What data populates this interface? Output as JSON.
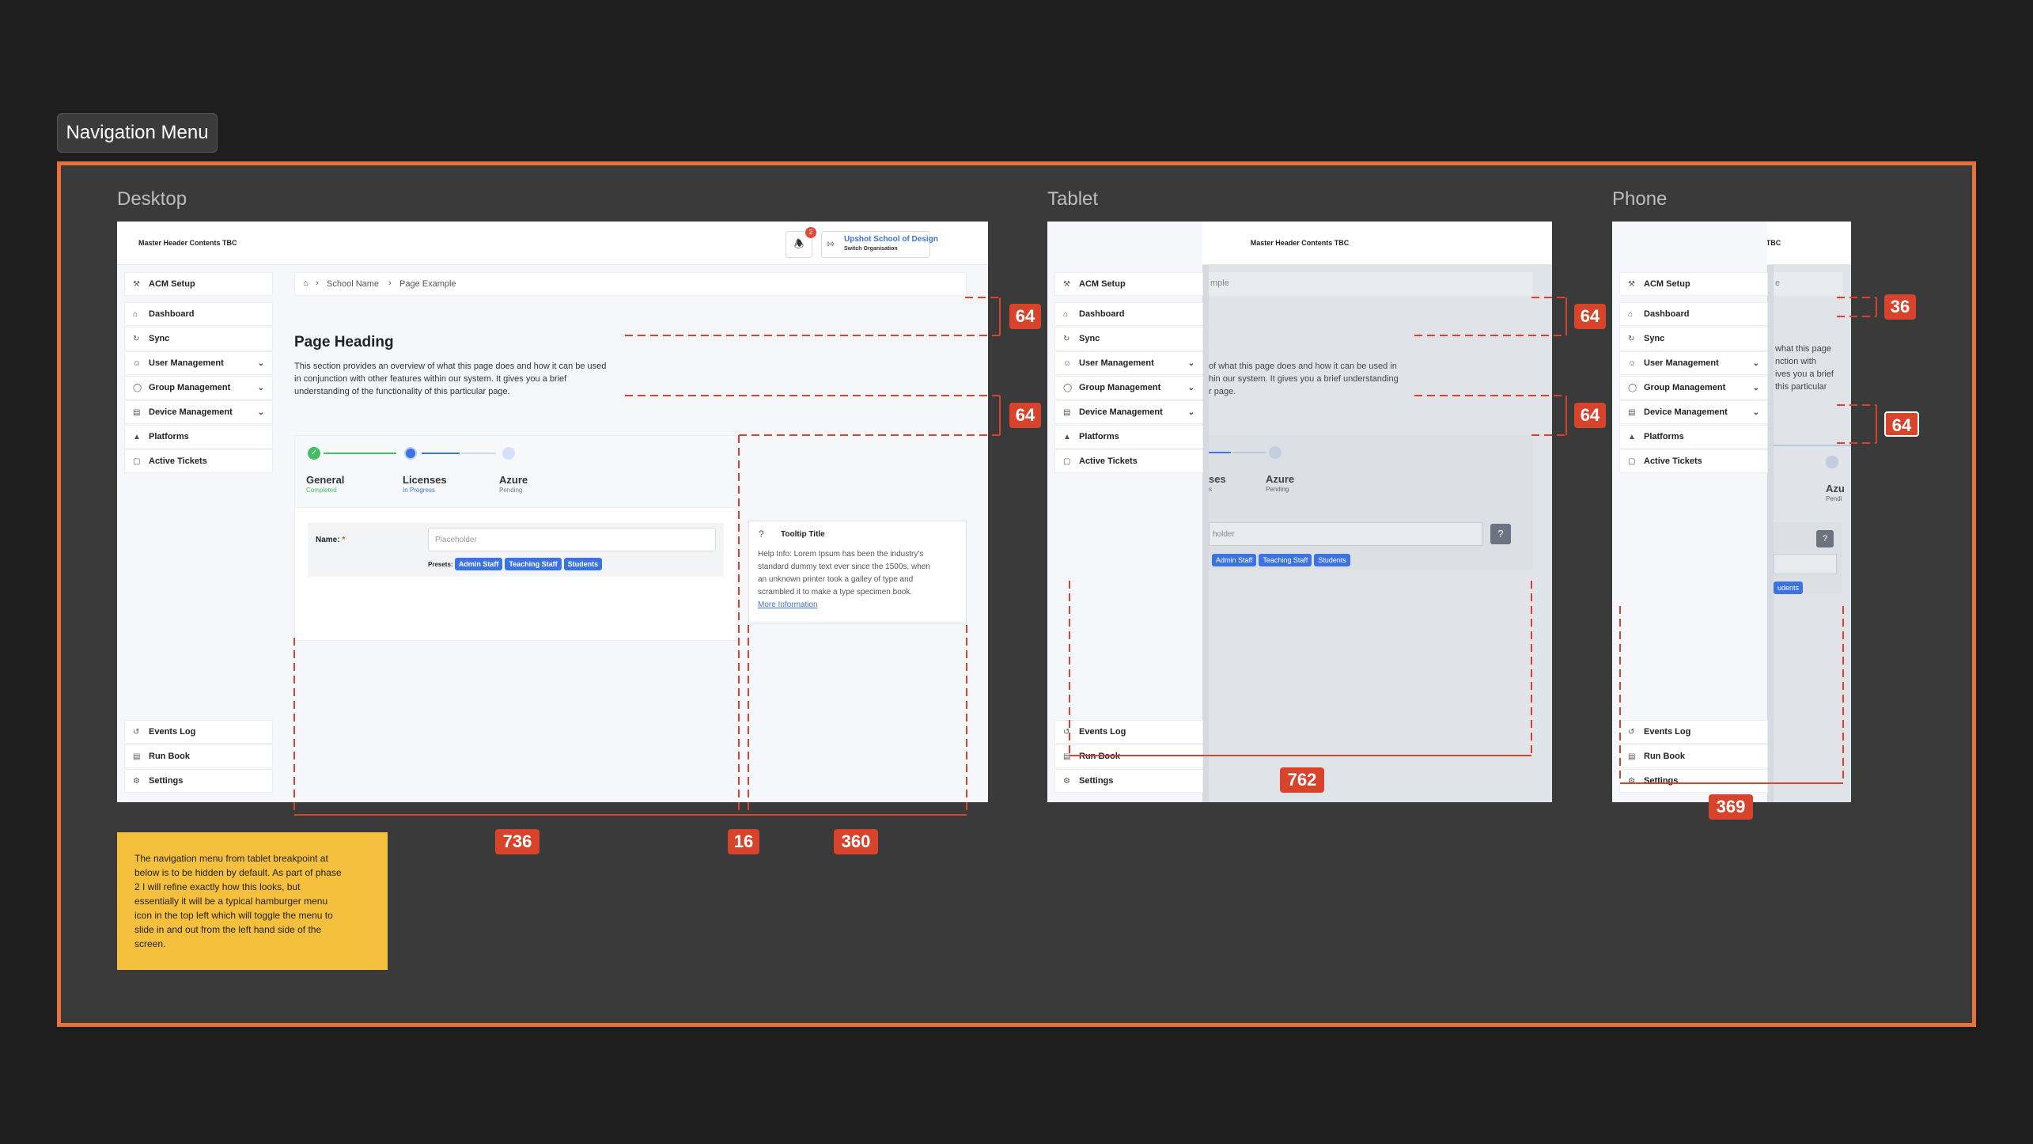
{
  "section_title": "Navigation Menu",
  "breakpoints": {
    "desktop": "Desktop",
    "tablet": "Tablet",
    "phone": "Phone"
  },
  "header": {
    "master_text": "Master Header Contents TBC",
    "notification_count": "2",
    "org_name": "Upshot School of Design",
    "org_sub": "Switch Organisation"
  },
  "nav": {
    "setup": "ACM Setup",
    "items": [
      {
        "label": "Dashboard",
        "icon": "home-icon",
        "chevron": false
      },
      {
        "label": "Sync",
        "icon": "sync-icon",
        "chevron": false
      },
      {
        "label": "User Management",
        "icon": "user-icon",
        "chevron": true
      },
      {
        "label": "Group Management",
        "icon": "group-icon",
        "chevron": true
      },
      {
        "label": "Device Management",
        "icon": "device-icon",
        "chevron": true
      },
      {
        "label": "Platforms",
        "icon": "platforms-icon",
        "chevron": false
      },
      {
        "label": "Active Tickets",
        "icon": "ticket-icon",
        "chevron": false
      }
    ],
    "bottom": [
      "Events Log",
      "Run Book",
      "Settings"
    ]
  },
  "breadcrumb": {
    "school": "School Name",
    "page": "Page Example"
  },
  "page": {
    "heading": "Page Heading",
    "desc_line1": "This section provides an overview of what this page does and how it can be used",
    "desc_line2": "in conjunction with other features within our system. It gives you a brief",
    "desc_line3": "understanding of the functionality of this particular page."
  },
  "tablet_page": {
    "breadcrumb": "mple",
    "desc_line1": "of what this page does and how it can be used in",
    "desc_line2": "hin our system. It gives you a brief understanding",
    "desc_line3": "r page.",
    "step_partial": "ses",
    "step_partial_status": "s"
  },
  "phone_page": {
    "breadcrumb": "e",
    "desc_line1": "what this page",
    "desc_line2": "nction with",
    "desc_line3": "ives you a brief",
    "desc_line4": "this particular",
    "step_partial": "Azu",
    "step_partial_status": "Pendi",
    "tag_partial": "udents"
  },
  "steps": [
    {
      "title": "General",
      "status": "Completed"
    },
    {
      "title": "Licenses",
      "status": "In Progress"
    },
    {
      "title": "Azure",
      "status": "Pending"
    }
  ],
  "form": {
    "name_label": "Name:",
    "required": "*",
    "placeholder": "Placeholder",
    "placeholder_partial": "holder",
    "presets_label": "Presets:",
    "presets": [
      "Admin Staff",
      "Teaching Staff",
      "Students"
    ]
  },
  "tooltip": {
    "title": "Tooltip Title",
    "body_line1": "Help Info: Lorem Ipsum has been the industry's",
    "body_line2": "standard dummy text ever since the 1500s, when",
    "body_line3": "an unknown printer took a galley of type and",
    "body_line4": "scrambled it to make a type specimen book.",
    "link": "More Information"
  },
  "measurements": {
    "desktop_top_gap": "64",
    "desktop_mid_gap": "64",
    "desktop_main_width": "736",
    "desktop_gutter": "16",
    "desktop_tooltip_width": "360",
    "tablet_top_gap": "64",
    "tablet_mid_gap": "64",
    "tablet_width": "762",
    "phone_top_gap": "36",
    "phone_mid_gap": "64",
    "phone_width": "369"
  },
  "note": {
    "line1": "The navigation menu from tablet breakpoint at",
    "line2": "below is to be hidden by default. As part of phase",
    "line3": "2 I will refine exactly how this looks, but",
    "line4": "essentially it will be a typical hamburger menu",
    "line5": "icon in the top left which will toggle the menu to",
    "line6": "slide in and out from the left hand side of the",
    "line7": "screen."
  },
  "colors": {
    "accent": "#e8733a",
    "annotation": "#d7442b",
    "primary": "#3c73e0",
    "success": "#3fbf62",
    "note": "#f4c03d"
  }
}
